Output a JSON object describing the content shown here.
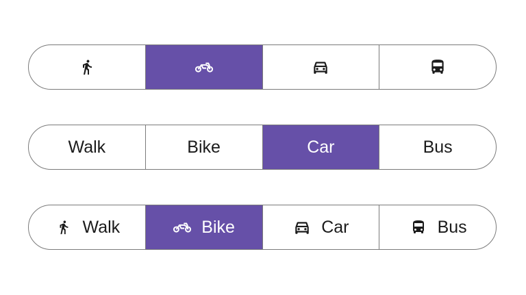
{
  "accent_color": "#6650a8",
  "icon_only_group": {
    "selected": "Bike",
    "options": [
      {
        "icon": "walk-icon",
        "selected": false
      },
      {
        "icon": "motorbike-icon",
        "selected": true
      },
      {
        "icon": "car-icon",
        "selected": false
      },
      {
        "icon": "bus-icon",
        "selected": false
      }
    ]
  },
  "text_only_group": {
    "selected": "Car",
    "options": [
      {
        "label": "Walk",
        "selected": false
      },
      {
        "label": "Bike",
        "selected": false
      },
      {
        "label": "Car",
        "selected": true
      },
      {
        "label": "Bus",
        "selected": false
      }
    ]
  },
  "icon_text_group": {
    "selected": "Bike",
    "options": [
      {
        "label": "Walk",
        "icon": "walk-icon",
        "selected": false
      },
      {
        "label": "Bike",
        "icon": "motorbike-icon",
        "selected": true
      },
      {
        "label": "Car",
        "icon": "car-icon",
        "selected": false
      },
      {
        "label": "Bus",
        "icon": "bus-icon",
        "selected": false
      }
    ]
  }
}
